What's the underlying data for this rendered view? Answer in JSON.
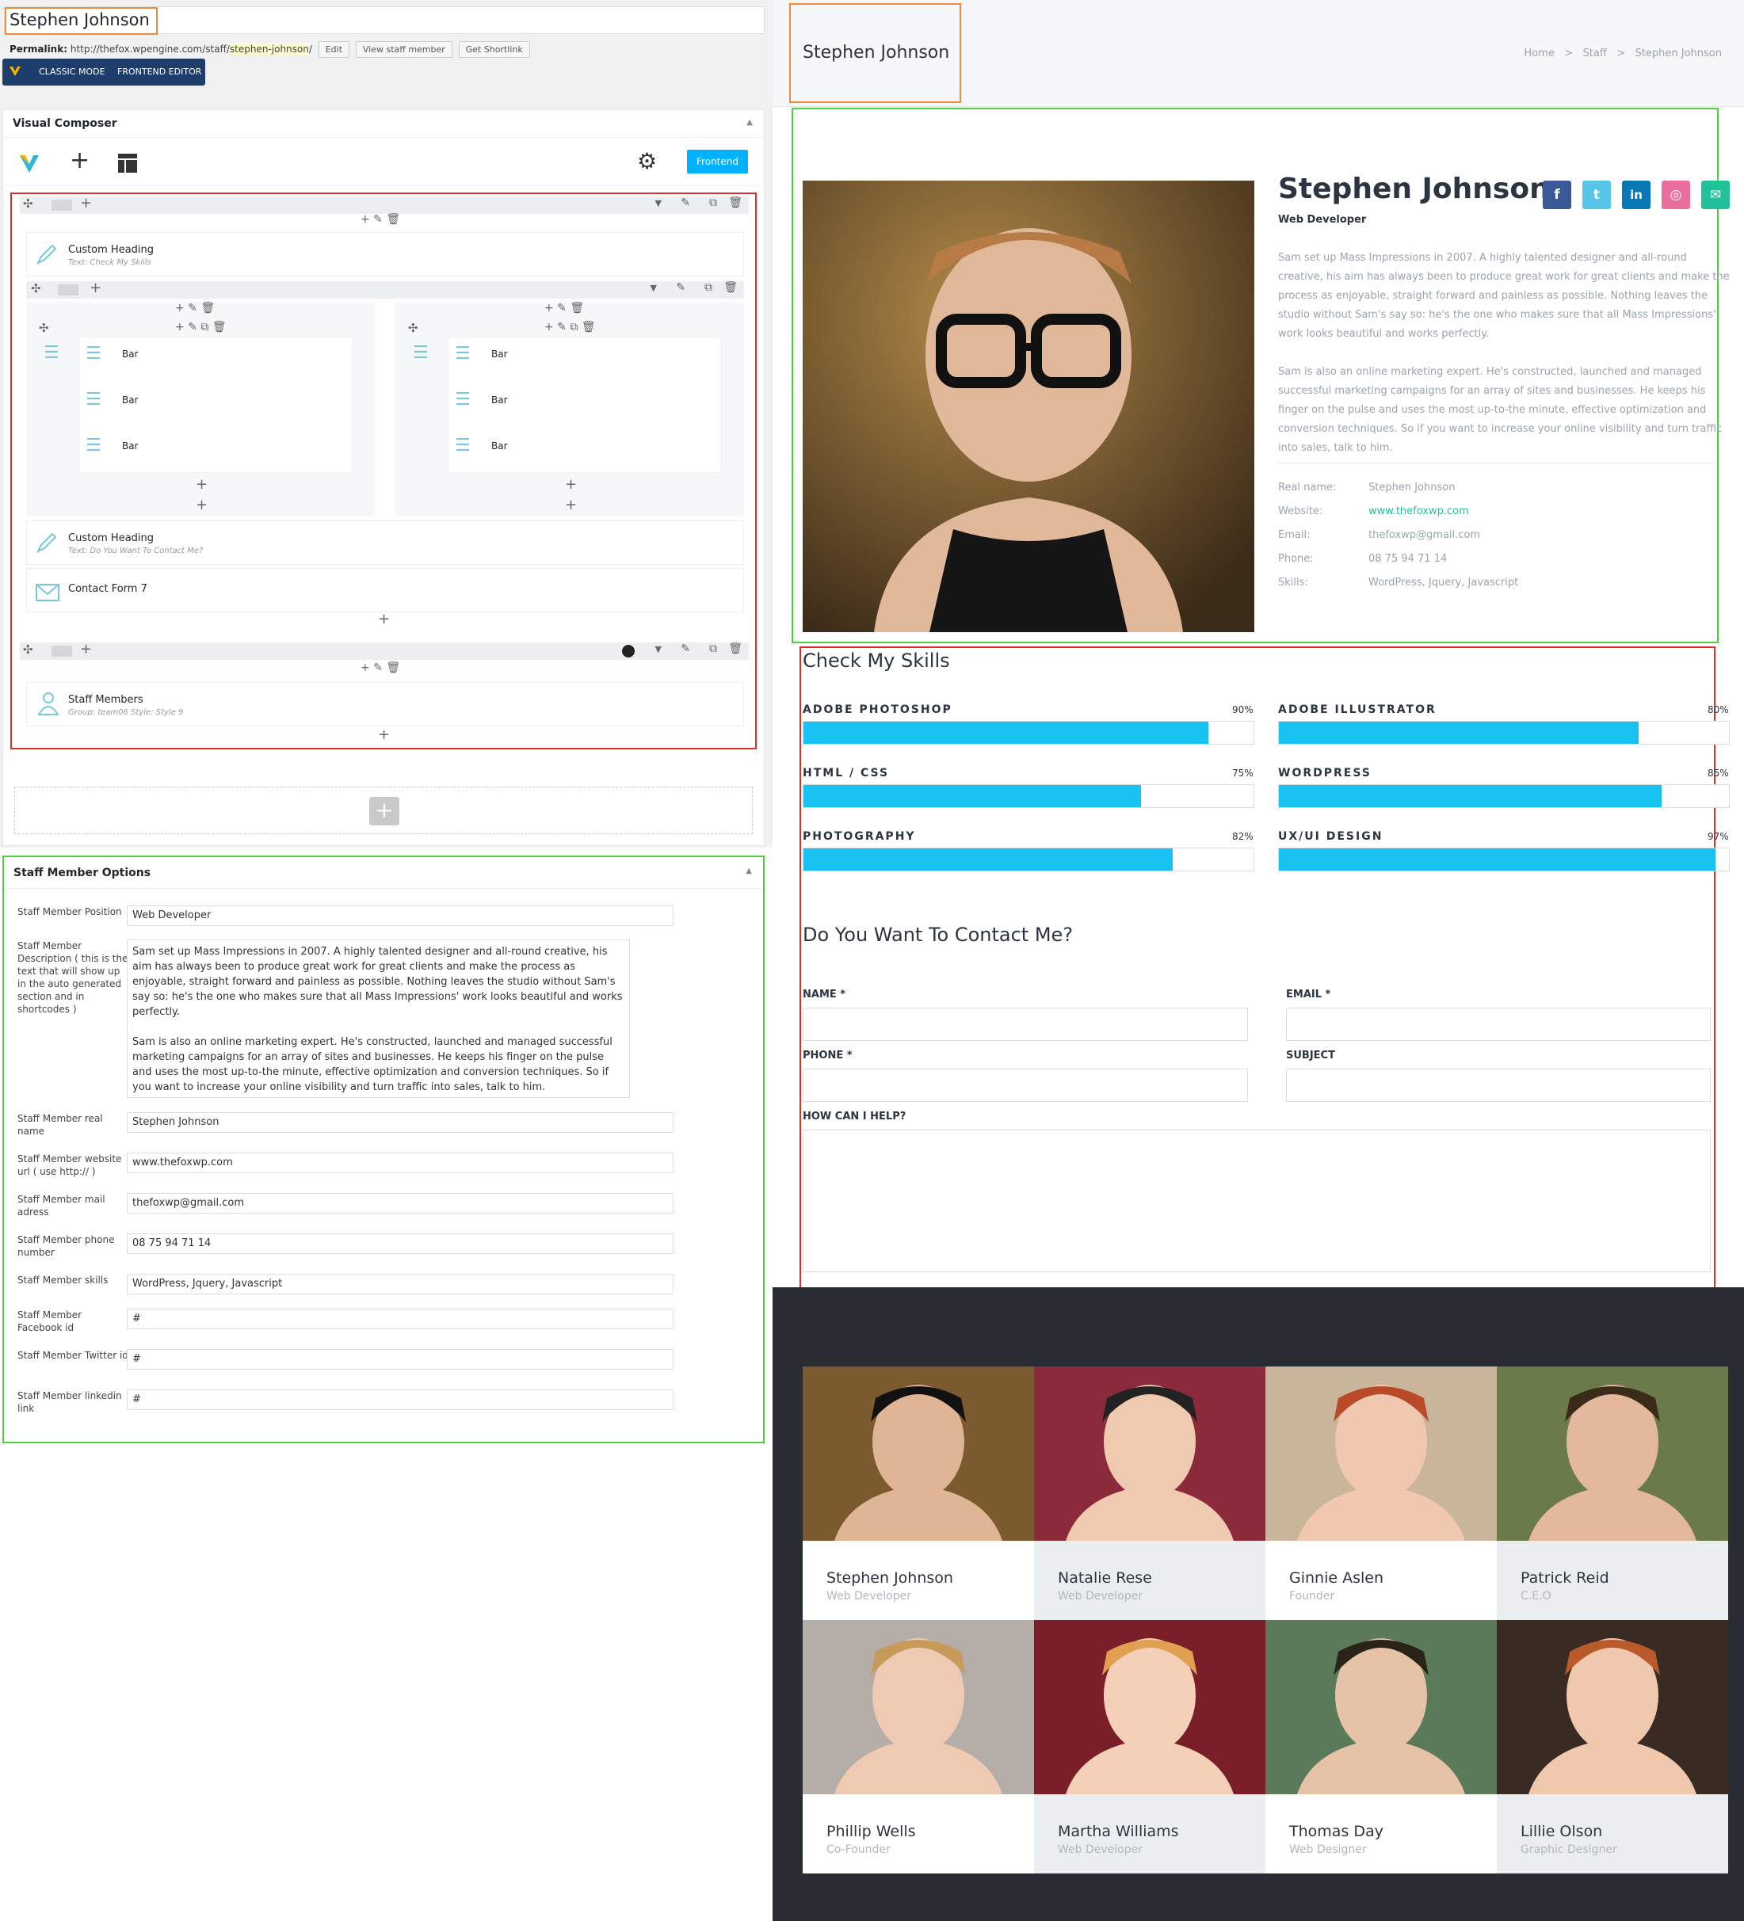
{
  "admin": {
    "title_value": "Stephen Johnson",
    "permalink_label": "Permalink:",
    "permalink_base": "http://thefox.wpengine.com/staff/",
    "permalink_slug": "stephen-johnson",
    "permalink_end": "/",
    "buttons": {
      "edit": "Edit",
      "view": "View staff member",
      "shortlink": "Get Shortlink"
    },
    "mode": {
      "classic": "CLASSIC MODE",
      "frontend": "FRONTEND EDITOR"
    },
    "vc_title": "Visual Composer",
    "frontend_btn": "Frontend",
    "elements": {
      "heading1_title": "Custom Heading",
      "heading1_sub": "Text: Check My Skills",
      "bar": "Bar",
      "heading2_title": "Custom Heading",
      "heading2_sub": "Text: Do You Want To Contact Me?",
      "contact_form": "Contact Form 7",
      "staff_title": "Staff Members",
      "staff_sub": "Group: team06  Style: Style 9"
    },
    "options": {
      "title": "Staff Member Options",
      "fields": [
        {
          "label": "Staff Member Position",
          "value": "Web Developer"
        },
        {
          "label": "Staff Member Description ( this is the text that will show up in the auto generated section and in shortcodes )",
          "value": "Sam set up Mass Impressions in 2007. A highly talented designer and all-round creative, his aim has always been to produce great work for great clients and make the process as enjoyable, straight forward and painless as possible. Nothing leaves the studio without Sam's say so: he's the one who makes sure that all Mass Impressions' work looks beautiful and works perfectly.\n\nSam is also an online marketing expert. He's constructed, launched and managed successful marketing campaigns for an array of sites and businesses. He keeps his finger on the pulse and uses the most up-to-the minute, effective optimization and conversion techniques. So if you want to increase your online visibility and turn traffic into sales, talk to him."
        },
        {
          "label": "Staff Member real name",
          "value": "Stephen Johnson"
        },
        {
          "label": "Staff Member website url ( use http:// )",
          "value": "www.thefoxwp.com"
        },
        {
          "label": "Staff Member mail adress",
          "value": "thefoxwp@gmail.com"
        },
        {
          "label": "Staff Member phone number",
          "value": "08 75 94 71 14"
        },
        {
          "label": "Staff Member skills",
          "value": "WordPress, Jquery, Javascript"
        },
        {
          "label": "Staff Member Facebook id",
          "value": "#"
        },
        {
          "label": "Staff Member Twitter id",
          "value": "#"
        },
        {
          "label": "Staff Member linkedin link",
          "value": "#"
        }
      ]
    }
  },
  "site": {
    "page_title": "Stephen Johnson",
    "breadcrumb": {
      "home": "Home",
      "staff": "Staff",
      "current": "Stephen Johnson",
      "sep": ">"
    },
    "profile": {
      "name": "Stephen Johnson",
      "role": "Web Developer",
      "desc1": "Sam set up Mass Impressions in 2007. A highly talented designer and all-round creative, his aim has always been to produce great work for great clients and make the process as enjoyable, straight forward and painless as possible. Nothing leaves the studio without Sam's say so: he's the one who makes sure that all Mass Impressions' work looks beautiful and works perfectly.",
      "desc2": "Sam is also an online marketing expert. He's constructed, launched and managed successful marketing campaigns for an array of sites and businesses. He keeps his finger on the pulse and uses the most up-to-the minute, effective optimization and conversion techniques. So if you want to increase your online visibility and turn traffic into sales, talk to him.",
      "info": [
        {
          "label": "Real name:",
          "value": "Stephen Johnson"
        },
        {
          "label": "Website:",
          "value": "www.thefoxwp.com"
        },
        {
          "label": "Email:",
          "value": "thefoxwp@gmail.com"
        },
        {
          "label": "Phone:",
          "value": "08 75 94 71 14"
        },
        {
          "label": "Skills:",
          "value": "WordPress, Jquery, Javascript"
        }
      ],
      "social_colors": {
        "facebook": "#3b5998",
        "twitter": "#55c5ea",
        "linkedin": "#0a77b5",
        "dribbble": "#ea6ea0",
        "email": "#21c29a"
      }
    },
    "skills_title": "Check My Skills",
    "skills": [
      {
        "name": "ADOBE PHOTOSHOP",
        "pct": "90%",
        "value": 90
      },
      {
        "name": "ADOBE ILLUSTRATOR",
        "pct": "80%",
        "value": 80
      },
      {
        "name": "HTML / CSS",
        "pct": "75%",
        "value": 75
      },
      {
        "name": "WORDPRESS",
        "pct": "85%",
        "value": 85
      },
      {
        "name": "PHOTOGRAPHY",
        "pct": "82%",
        "value": 82
      },
      {
        "name": "UX/UI DESIGN",
        "pct": "97%",
        "value": 97
      }
    ],
    "contact_title": "Do You Want To Contact Me?",
    "form": {
      "name": "NAME *",
      "email": "EMAIL *",
      "phone": "PHONE *",
      "subject": "SUBJECT",
      "help": "HOW CAN I HELP?"
    },
    "team": [
      {
        "name": "Stephen Johnson",
        "role": "Web Developer"
      },
      {
        "name": "Natalie Rese",
        "role": "Web Developer"
      },
      {
        "name": "Ginnie Aslen",
        "role": "Founder"
      },
      {
        "name": "Patrick Reid",
        "role": "C.E.O"
      },
      {
        "name": "Phillip Wells",
        "role": "Co-Founder"
      },
      {
        "name": "Martha Williams",
        "role": "Web Developer"
      },
      {
        "name": "Thomas Day",
        "role": "Web Designer"
      },
      {
        "name": "Lillie Olson",
        "role": "Graphic Designer"
      }
    ]
  }
}
